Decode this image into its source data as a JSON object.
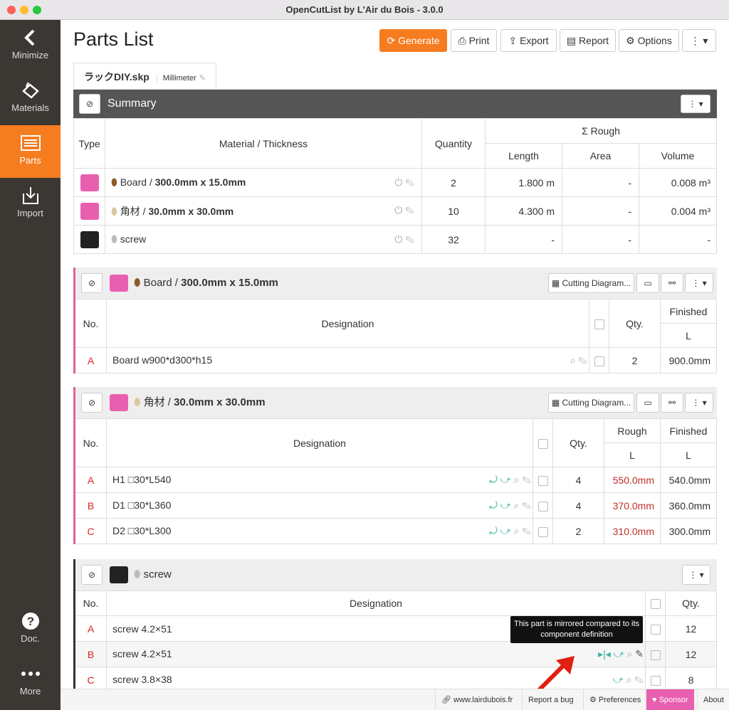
{
  "window": {
    "title": "OpenCutList by L'Air du Bois - 3.0.0"
  },
  "sidebar": {
    "items": [
      {
        "label": "Minimize",
        "icon": "chevron-left-icon"
      },
      {
        "label": "Materials",
        "icon": "materials-icon"
      },
      {
        "label": "Parts",
        "icon": "parts-list-icon"
      },
      {
        "label": "Import",
        "icon": "import-icon"
      },
      {
        "label": "Doc.",
        "icon": "question-icon"
      },
      {
        "label": "More",
        "icon": "dots-icon"
      }
    ]
  },
  "header": {
    "title": "Parts List",
    "buttons": {
      "generate": "Generate",
      "print": "Print",
      "export": "Export",
      "report": "Report",
      "options": "Options"
    }
  },
  "file": {
    "name": "ラックDIY.skp",
    "unit": "Millimeter"
  },
  "summary": {
    "title": "Summary",
    "headers": {
      "type": "Type",
      "material": "Material / Thickness",
      "quantity": "Quantity",
      "rough": "Σ Rough",
      "length": "Length",
      "area": "Area",
      "volume": "Volume"
    },
    "rows": [
      {
        "mat": "Board / ",
        "dims": "300.0mm x 15.0mm",
        "qty": "2",
        "length": "1.800 m",
        "area": "-",
        "volume": "0.008 m³"
      },
      {
        "mat": "角材 / ",
        "dims": "30.0mm x 30.0mm",
        "qty": "10",
        "length": "4.300 m",
        "area": "-",
        "volume": "0.004 m³"
      },
      {
        "mat": "screw",
        "dims": "",
        "qty": "32",
        "length": "-",
        "area": "-",
        "volume": "-"
      }
    ]
  },
  "groups": {
    "board": {
      "mat": "Board / ",
      "dims": "300.0mm x 15.0mm",
      "cutting": "Cutting Diagram...",
      "h_no": "No.",
      "h_des": "Designation",
      "h_qty": "Qty.",
      "h_fin": "Finished",
      "h_L": "L",
      "rows": [
        {
          "no": "A",
          "name": "Board w900*d300*h15",
          "qty": "2",
          "fin": "900.0mm"
        }
      ]
    },
    "kakuzai": {
      "mat": "角材 / ",
      "dims": "30.0mm x 30.0mm",
      "cutting": "Cutting Diagram...",
      "h_no": "No.",
      "h_des": "Designation",
      "h_qty": "Qty.",
      "h_rough": "Rough",
      "h_fin": "Finished",
      "h_L": "L",
      "h_L2": "L",
      "rows": [
        {
          "no": "A",
          "name": "H1 □30*L540",
          "qty": "4",
          "rough": "550.0mm",
          "fin": "540.0mm"
        },
        {
          "no": "B",
          "name": "D1 □30*L360",
          "qty": "4",
          "rough": "370.0mm",
          "fin": "360.0mm"
        },
        {
          "no": "C",
          "name": "D2 □30*L300",
          "qty": "2",
          "rough": "310.0mm",
          "fin": "300.0mm"
        }
      ]
    },
    "screw": {
      "mat": "screw",
      "h_no": "No.",
      "h_des": "Designation",
      "h_qty": "Qty.",
      "rows": [
        {
          "no": "A",
          "name": "screw 4.2×51",
          "qty": "12"
        },
        {
          "no": "B",
          "name": "screw 4.2×51",
          "qty": "12"
        },
        {
          "no": "C",
          "name": "screw 3.8×38",
          "qty": "8"
        }
      ]
    }
  },
  "tooltip": "This part is mirrored compared to its component definition",
  "footer": {
    "website": "www.lairdubois.fr",
    "bug": "Report a bug",
    "prefs": "Preferences",
    "sponsor": "Sponsor",
    "about": "About"
  },
  "colors": {
    "accent": "#f57c1f",
    "pink": "#e95fb0",
    "rough": "#c0302a"
  }
}
